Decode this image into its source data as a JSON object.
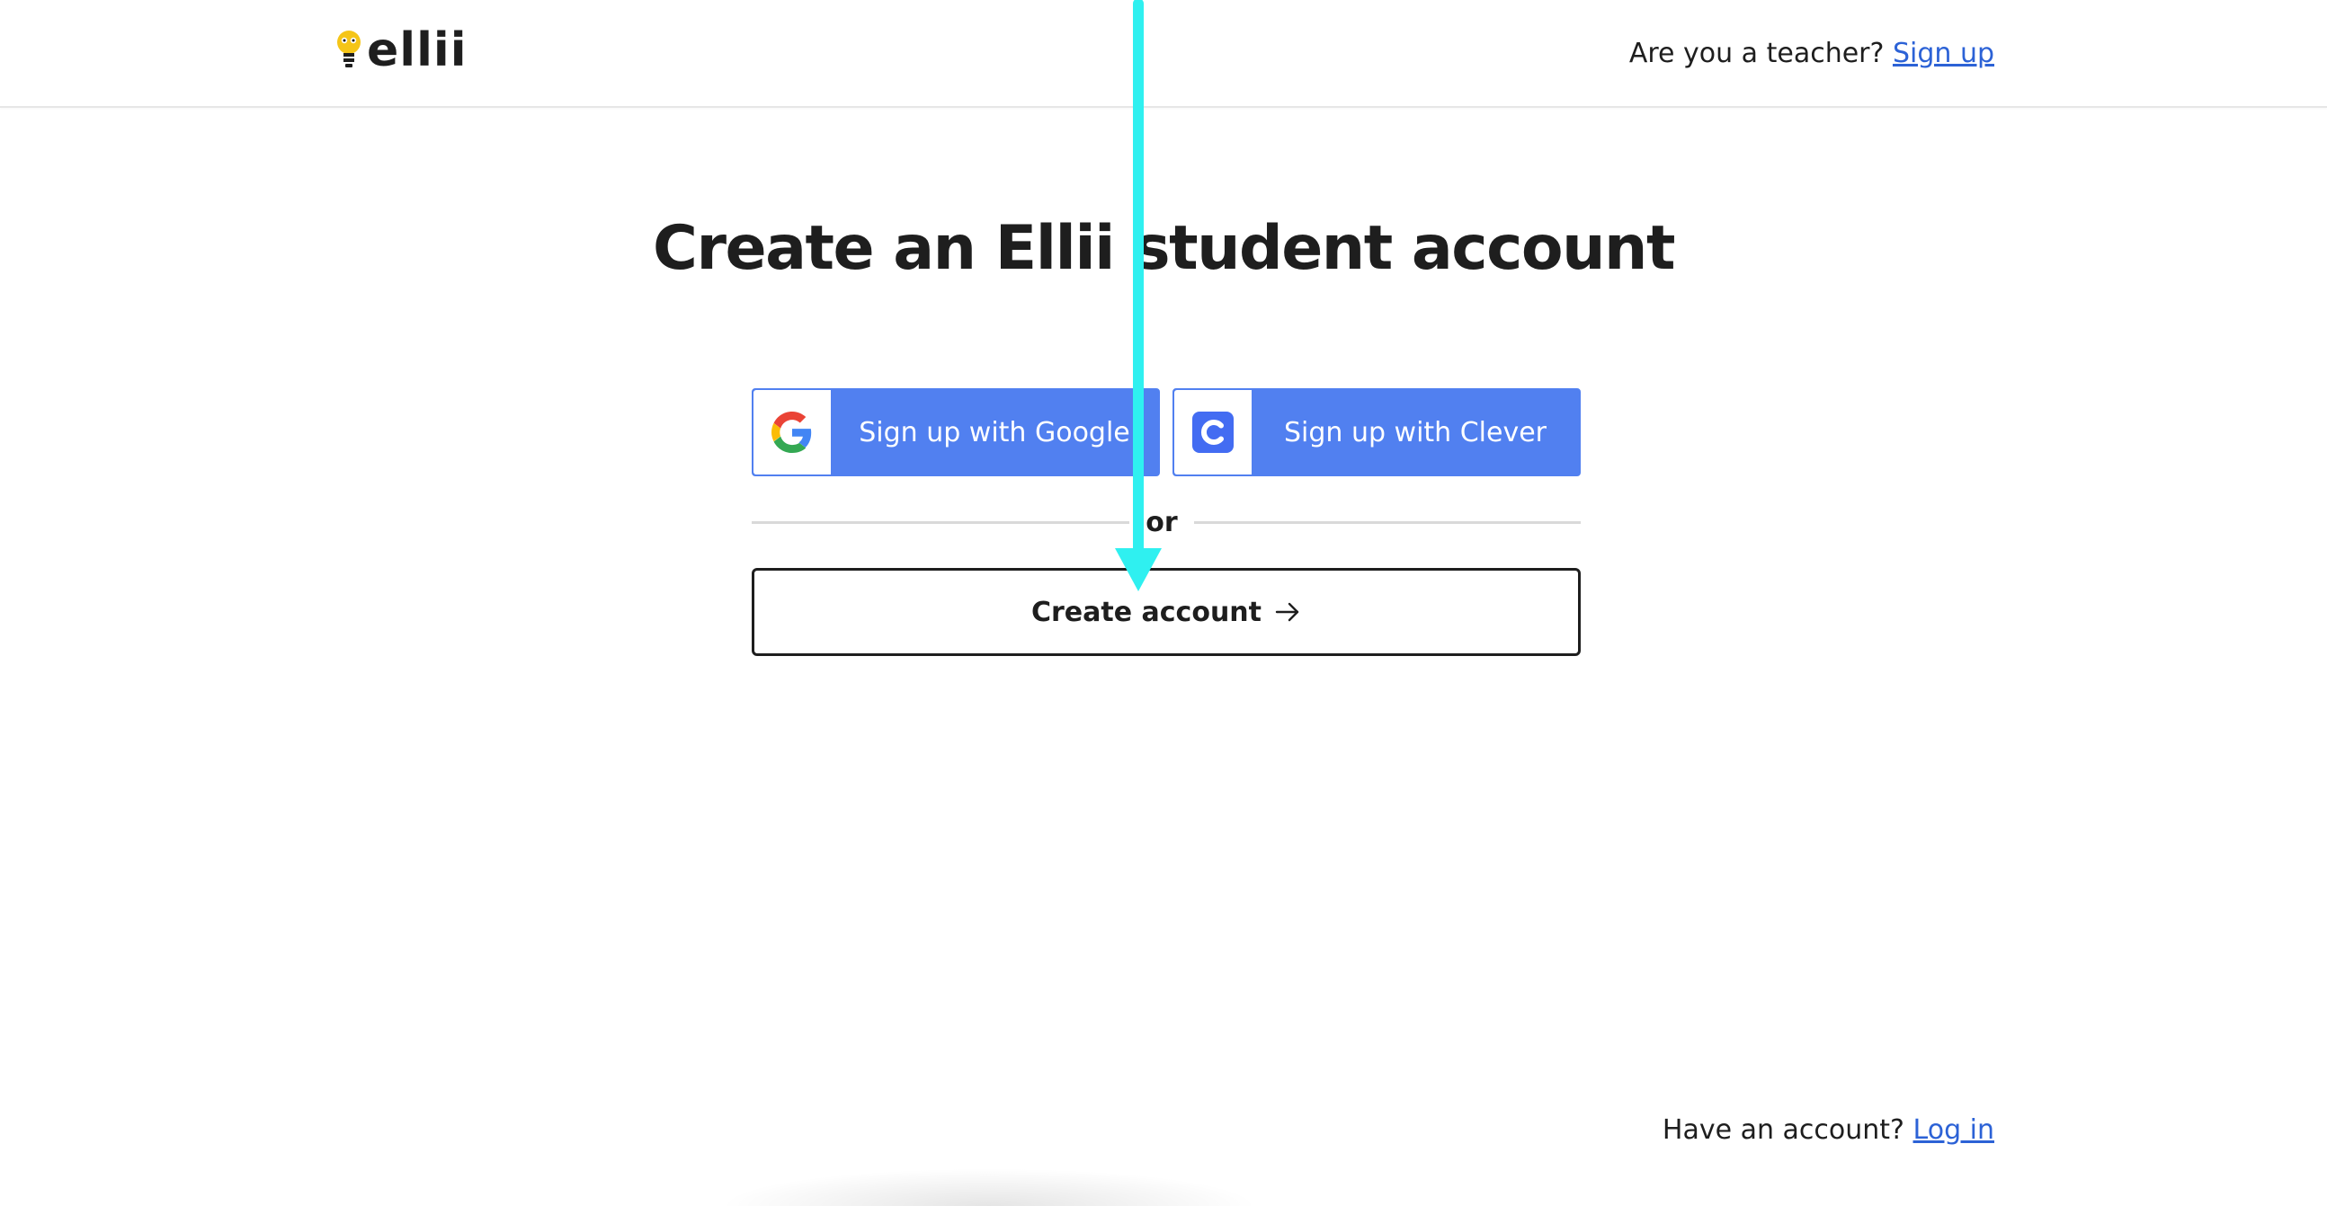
{
  "header": {
    "logo_text": "ellii",
    "teacher_prompt": "Are you a teacher?",
    "teacher_signup_link": "Sign up"
  },
  "main": {
    "title": "Create an Ellii student account",
    "google_button_label": "Sign up with Google",
    "clever_button_label": "Sign up with Clever",
    "divider_text": "or",
    "create_account_label": "Create account"
  },
  "footer": {
    "have_account_prompt": "Have an account?",
    "login_link": "Log in"
  },
  "colors": {
    "sso_button": "#5180f0",
    "link": "#2c62d6",
    "annotation_arrow": "#2ff0f0",
    "logo_bulb": "#f5c518"
  },
  "icons": {
    "google": "google-g-icon",
    "clever": "clever-c-icon",
    "arrow": "arrow-right-icon",
    "logo": "lightbulb-icon"
  }
}
